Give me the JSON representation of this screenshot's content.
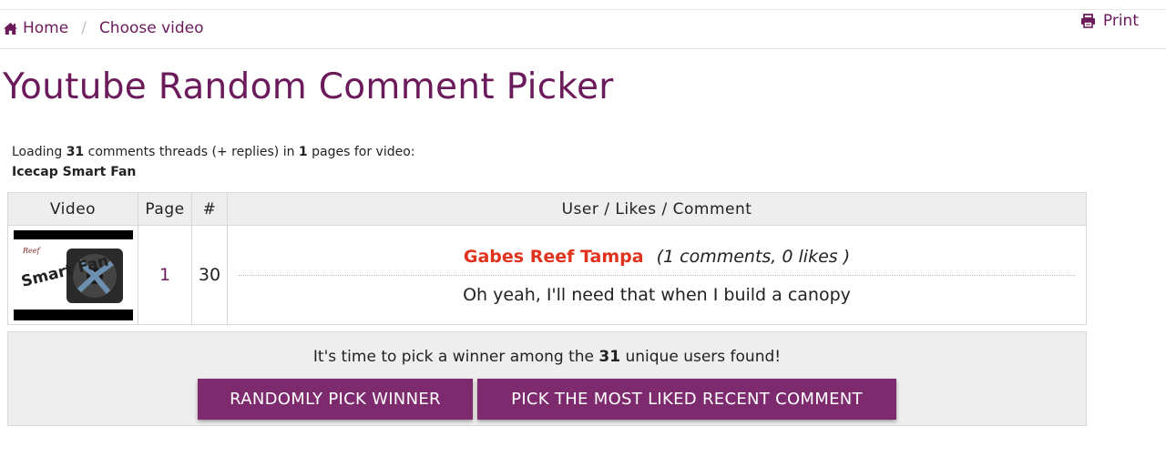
{
  "breadcrumb": {
    "home_label": "Home",
    "separator": "/",
    "current_label": "Choose video"
  },
  "print_label": "Print",
  "title": "Youtube Random Comment Picker",
  "loading": {
    "prefix": "Loading ",
    "thread_count": "31",
    "middle": " comments threads (+ replies) in ",
    "page_count": "1",
    "suffix": " pages for video:",
    "video_title": "Icecap Smart Fan"
  },
  "table": {
    "headers": [
      "Video",
      "Page",
      "#",
      "User / Likes / Comment"
    ],
    "row": {
      "page": "1",
      "number": "30",
      "username": "Gabes Reef Tampa",
      "meta": "(1 comments, 0 likes )",
      "comment": "Oh yeah, I'll need that when I build a canopy",
      "thumbnail_text": "Smart Fan"
    }
  },
  "winner": {
    "prefix": "It's time to pick a winner among the ",
    "unique_count": "31",
    "suffix": " unique users found!",
    "random_button": "RANDOMLY PICK WINNER",
    "liked_button": "PICK THE MOST LIKED RECENT COMMENT"
  },
  "colors": {
    "brand": "#6b1a5b",
    "button": "#7e2a6e",
    "username": "#e0331d"
  },
  "icons": [
    "home-icon",
    "printer-icon"
  ]
}
